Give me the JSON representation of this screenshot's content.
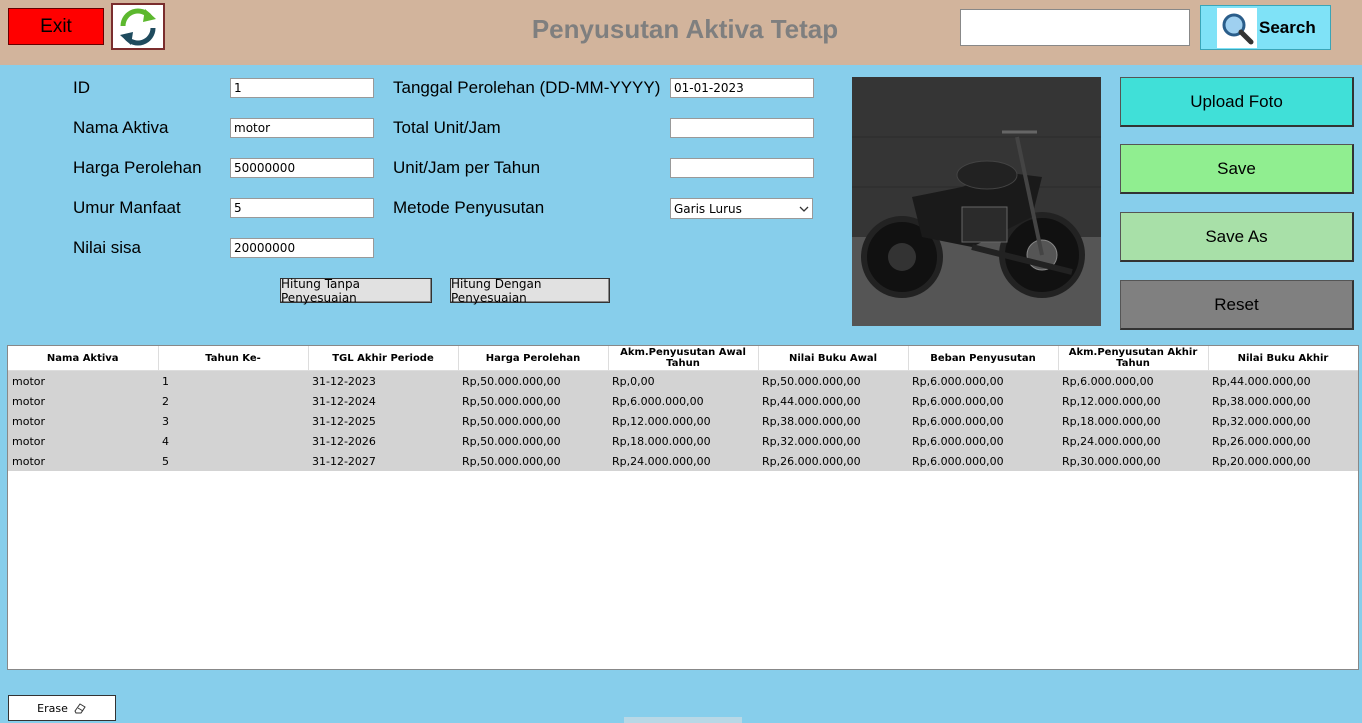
{
  "header": {
    "exit_label": "Exit",
    "refresh_icon": "refresh-icon",
    "title": "Penyusutan Aktiva Tetap",
    "search_value": "",
    "search_label": "Search",
    "search_icon": "magnifier-icon"
  },
  "form": {
    "id_label": "ID",
    "id_value": "1",
    "nama_label": "Nama Aktiva",
    "nama_value": "motor",
    "harga_label": "Harga Perolehan",
    "harga_value": "50000000",
    "umur_label": "Umur Manfaat",
    "umur_value": "5",
    "nilai_sisa_label": "Nilai sisa",
    "nilai_sisa_value": "20000000",
    "tanggal_label": "Tanggal Perolehan (DD-MM-YYYY)",
    "tanggal_value": "01-01-2023",
    "total_unit_label": "Total Unit/Jam",
    "total_unit_value": "",
    "unit_tahun_label": "Unit/Jam per Tahun",
    "unit_tahun_value": "",
    "metode_label": "Metode Penyusutan",
    "metode_value": "Garis Lurus",
    "btn_tanpa": "Hitung Tanpa Penyesuaian",
    "btn_dengan": "Hitung Dengan Penyesuaian"
  },
  "side": {
    "upload": "Upload Foto",
    "save": "Save",
    "save_as": "Save As",
    "reset": "Reset"
  },
  "colors": {
    "background": "#87ceeb",
    "header": "#d2b49c",
    "exit": "#ff0000",
    "upload": "#40e0d8",
    "save": "#90ee90",
    "save_as": "#a8e0a8",
    "reset": "#808080"
  },
  "table": {
    "columns": [
      "Nama Aktiva",
      "Tahun Ke-",
      "TGL Akhir Periode",
      "Harga Perolehan",
      "Akm.Penyusutan Awal Tahun",
      "Nilai Buku Awal",
      "Beban Penyusutan",
      "Akm.Penyusutan Akhir Tahun",
      "Nilai Buku Akhir"
    ],
    "rows": [
      [
        "motor",
        "1",
        "31-12-2023",
        "Rp,50.000.000,00",
        "Rp,0,00",
        "Rp,50.000.000,00",
        "Rp,6.000.000,00",
        "Rp,6.000.000,00",
        "Rp,44.000.000,00"
      ],
      [
        "motor",
        "2",
        "31-12-2024",
        "Rp,50.000.000,00",
        "Rp,6.000.000,00",
        "Rp,44.000.000,00",
        "Rp,6.000.000,00",
        "Rp,12.000.000,00",
        "Rp,38.000.000,00"
      ],
      [
        "motor",
        "3",
        "31-12-2025",
        "Rp,50.000.000,00",
        "Rp,12.000.000,00",
        "Rp,38.000.000,00",
        "Rp,6.000.000,00",
        "Rp,18.000.000,00",
        "Rp,32.000.000,00"
      ],
      [
        "motor",
        "4",
        "31-12-2026",
        "Rp,50.000.000,00",
        "Rp,18.000.000,00",
        "Rp,32.000.000,00",
        "Rp,6.000.000,00",
        "Rp,24.000.000,00",
        "Rp,26.000.000,00"
      ],
      [
        "motor",
        "5",
        "31-12-2027",
        "Rp,50.000.000,00",
        "Rp,24.000.000,00",
        "Rp,26.000.000,00",
        "Rp,6.000.000,00",
        "Rp,30.000.000,00",
        "Rp,20.000.000,00"
      ]
    ]
  },
  "footer": {
    "erase_label": "Erase",
    "erase_icon": "eraser-icon"
  }
}
